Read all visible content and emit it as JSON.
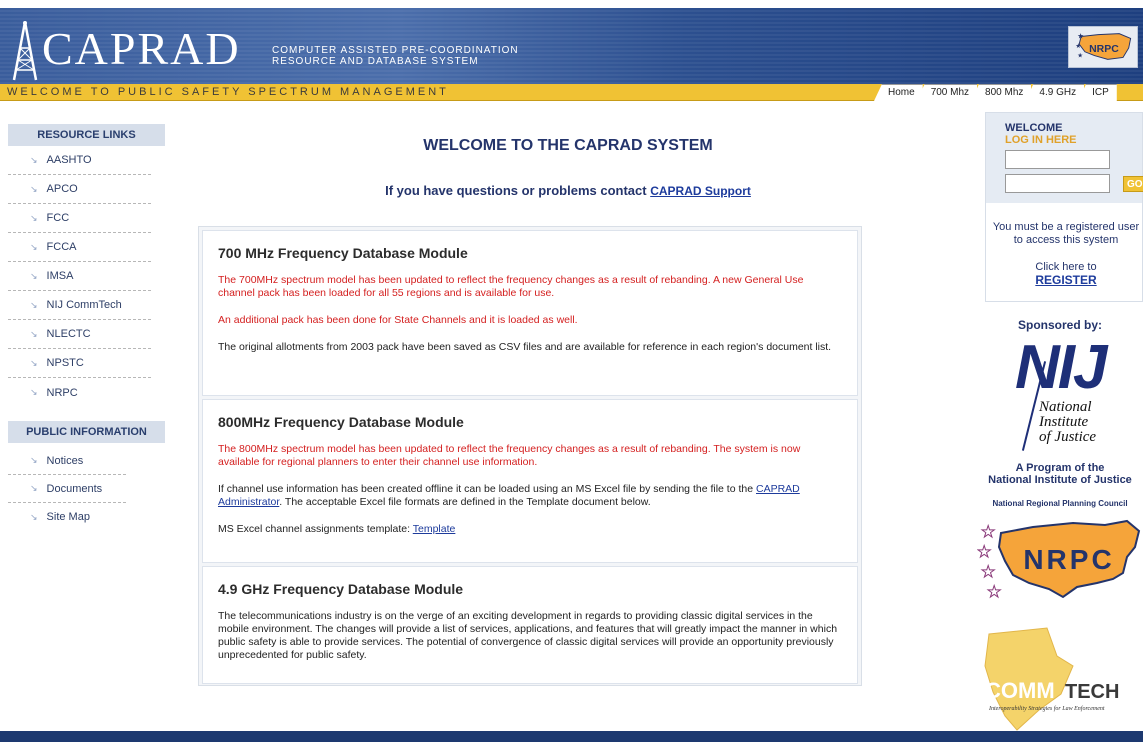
{
  "header": {
    "logo_text": "CAPRAD",
    "tagline_1": "COMPUTER ASSISTED PRE-COORDINATION",
    "tagline_2": "RESOURCE AND DATABASE SYSTEM",
    "badge": "NRPC",
    "welcome": "WELCOME TO PUBLIC SAFETY SPECTRUM MANAGEMENT",
    "tabs": [
      "Home",
      "700 Mhz",
      "800 Mhz",
      "4.9 GHz",
      "ICP"
    ]
  },
  "sidebar": {
    "resource_title": "RESOURCE LINKS",
    "resource_links": [
      "AASHTO",
      "APCO",
      "FCC",
      "FCCA",
      "IMSA",
      "NIJ CommTech",
      "NLECTC",
      "NPSTC",
      "NRPC"
    ],
    "public_title": "PUBLIC INFORMATION",
    "public_links": [
      "Notices",
      "Documents",
      "Site Map"
    ]
  },
  "main": {
    "title": "WELCOME TO THE CAPRAD SYSTEM",
    "contact_text": "If you have questions or problems contact",
    "contact_link": "CAPRAD Support",
    "modules": [
      {
        "title": "700 MHz Frequency Database Module",
        "p1": "The 700MHz spectrum model has been updated to reflect the frequency changes as a result of rebanding. A new General Use channel pack has been loaded for all 55 regions and is available for use.",
        "p2": "An additional pack has been done for State Channels and it is loaded as well.",
        "p3": "The original allotments from 2003 pack have been saved as CSV files and are available for reference in each region's document list."
      },
      {
        "title": "800MHz Frequency Database Module",
        "p1": "The 800MHz spectrum model has been updated to reflect the frequency changes as a result of rebanding. The system is now available for regional planners to enter their channel use information.",
        "p2a": "If channel use information has been created offline it can be loaded using an MS Excel file by sending the file to the",
        "p2link": "CAPRAD Administrator",
        "p2b": ". The acceptable Excel file formats are defined in the Template document below.",
        "p3a": "MS Excel channel assignments template:",
        "p3link": "Template"
      },
      {
        "title": "4.9 GHz Frequency Database Module",
        "p1": "The telecommunications industry is on the verge of an exciting development in regards to providing classic digital services in the mobile environment. The changes will provide a list of services, applications, and features that will greatly impact the manner in which public safety is able to provide services. The potential of convergence of classic digital services will provide an opportunity previously unprecedented for public safety."
      }
    ]
  },
  "login": {
    "welcome": "WELCOME",
    "login_here": "LOG IN HERE",
    "go": "GO",
    "note": "You must be a registered user to access this system",
    "click": "Click here to",
    "register": "REGISTER"
  },
  "sponsor": {
    "heading": "Sponsored by:",
    "nij_big": "NIJ",
    "nij_1": "National",
    "nij_2": "Institute",
    "nij_3": "of Justice",
    "program_1": "A Program of the",
    "program_2": "National Institute of Justice",
    "nrpc_label": "National Regional Planning Council",
    "nrpc_map_text": "NRPC",
    "commtech_1": "COMM",
    "commtech_2": "TECH",
    "commtech_sub": "Interoperability Strategies for Law Enforcement"
  },
  "colors": {
    "header_blue": "#3a5d9c",
    "yellow_bar": "#f0c234",
    "title_navy": "#24346b",
    "alert_red": "#d42020",
    "nrpc_orange": "#f5a43a"
  }
}
